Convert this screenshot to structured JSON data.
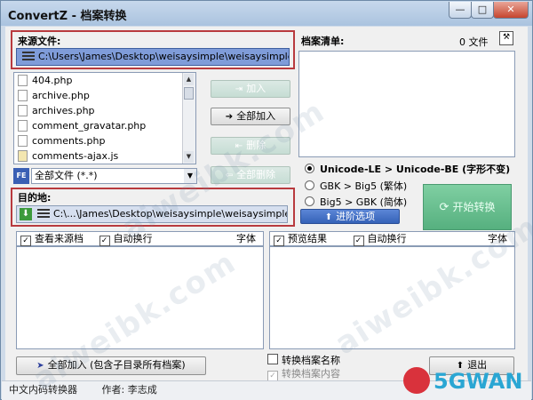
{
  "window": {
    "title": "ConvertZ - 档案转换",
    "buttons": {
      "minimize": "—",
      "maximize": "□",
      "close": "✕"
    }
  },
  "source": {
    "label": "来源文件:",
    "path": "C:\\Users\\James\\Desktop\\weisaysimple\\weisaysimple",
    "files": [
      "404.php",
      "archive.php",
      "archives.php",
      "comment_gravatar.php",
      "comments.php",
      "comments-ajax.js"
    ],
    "filter_badge": "FE",
    "filter_value": "全部文件 (*.*)"
  },
  "actions": {
    "add": "加入",
    "add_all": "全部加入",
    "remove": "删除",
    "remove_all": "全部删除"
  },
  "file_list": {
    "label": "档案清单:",
    "count": "0 文件"
  },
  "destination": {
    "label": "目的地:",
    "path": "C:\\...\\James\\Desktop\\weisaysimple\\weisaysimple-new"
  },
  "conversion": {
    "options": [
      {
        "label": "Unicode-LE > Unicode-BE (字形不变)",
        "selected": true
      },
      {
        "label": "GBK > Big5 (繁体)",
        "selected": false
      },
      {
        "label": "Big5 > GBK (简体)",
        "selected": false
      }
    ],
    "advanced": "进阶选项",
    "start": "开始转换"
  },
  "left_panel": {
    "view_source": "查看来源档",
    "auto_wrap": "自动换行",
    "font": "字体"
  },
  "right_panel": {
    "preview": "预览结果",
    "auto_wrap": "自动换行",
    "font": "字体"
  },
  "bottom": {
    "add_all_sub": "全部加入 (包含子目录所有档案)",
    "rename": "转换档案名称",
    "convert_content": "转换档案内容",
    "exit": "退出"
  },
  "status": {
    "app": "中文内码转换器",
    "author": "作者: 李志成"
  },
  "watermarks": [
    "aiweibk.com",
    "aiweibk.com",
    "aiweibk.com"
  ],
  "logo": "5GWAN"
}
